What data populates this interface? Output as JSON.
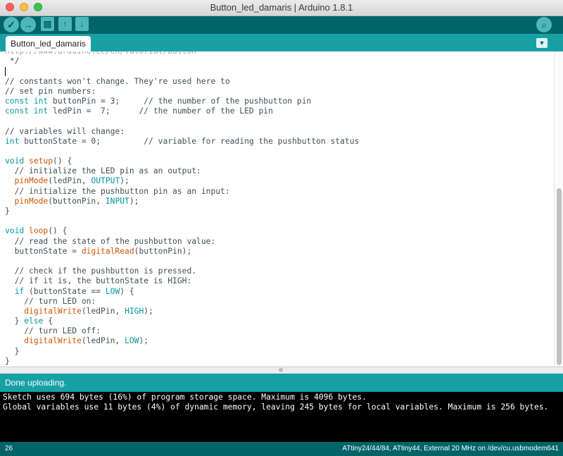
{
  "window": {
    "title": "Button_led_damaris | Arduino 1.8.1"
  },
  "toolbar": {
    "verify_icon": "✓",
    "upload_icon": "→",
    "new_icon": "▤",
    "open_icon": "↑",
    "save_icon": "↓",
    "serial_icon": "⌕"
  },
  "tabs": [
    {
      "label": "Button_led_damaris"
    }
  ],
  "tab_menu_icon": "▼",
  "editor": {
    "lines": [
      [
        {
          "t": "http://www.arduino.cc/en/Tutorial/Button",
          "c": "fade"
        }
      ],
      [
        {
          "t": " */",
          "c": "cmt"
        }
      ],
      [
        {
          "t": "",
          "c": "caret"
        }
      ],
      [
        {
          "t": "// constants won't change. They're used here to",
          "c": "cmt"
        }
      ],
      [
        {
          "t": "// set pin numbers:",
          "c": "cmt"
        }
      ],
      [
        {
          "t": "const",
          "c": "kw"
        },
        {
          "t": " "
        },
        {
          "t": "int",
          "c": "kw"
        },
        {
          "t": " buttonPin = 3;     "
        },
        {
          "t": "// the number of the pushbutton pin",
          "c": "cmt"
        }
      ],
      [
        {
          "t": "const",
          "c": "kw"
        },
        {
          "t": " "
        },
        {
          "t": "int",
          "c": "kw"
        },
        {
          "t": " ledPin =  7;      "
        },
        {
          "t": "// the number of the LED pin",
          "c": "cmt"
        }
      ],
      [
        {
          "t": ""
        }
      ],
      [
        {
          "t": "// variables will change:",
          "c": "cmt"
        }
      ],
      [
        {
          "t": "int",
          "c": "kw"
        },
        {
          "t": " buttonState = 0;         "
        },
        {
          "t": "// variable for reading the pushbutton status",
          "c": "cmt"
        }
      ],
      [
        {
          "t": ""
        }
      ],
      [
        {
          "t": "void",
          "c": "kw"
        },
        {
          "t": " "
        },
        {
          "t": "setup",
          "c": "fn"
        },
        {
          "t": "() {"
        }
      ],
      [
        {
          "t": "  // initialize the LED pin as an output:",
          "c": "cmt"
        }
      ],
      [
        {
          "t": "  "
        },
        {
          "t": "pinMode",
          "c": "fn"
        },
        {
          "t": "(ledPin, "
        },
        {
          "t": "OUTPUT",
          "c": "lit"
        },
        {
          "t": ");"
        }
      ],
      [
        {
          "t": "  // initialize the pushbutton pin as an input:",
          "c": "cmt"
        }
      ],
      [
        {
          "t": "  "
        },
        {
          "t": "pinMode",
          "c": "fn"
        },
        {
          "t": "(buttonPin, "
        },
        {
          "t": "INPUT",
          "c": "lit"
        },
        {
          "t": ");"
        }
      ],
      [
        {
          "t": "}"
        }
      ],
      [
        {
          "t": ""
        }
      ],
      [
        {
          "t": "void",
          "c": "kw"
        },
        {
          "t": " "
        },
        {
          "t": "loop",
          "c": "fn"
        },
        {
          "t": "() {"
        }
      ],
      [
        {
          "t": "  // read the state of the pushbutton value:",
          "c": "cmt"
        }
      ],
      [
        {
          "t": "  buttonState = "
        },
        {
          "t": "digitalRead",
          "c": "fn"
        },
        {
          "t": "(buttonPin);"
        }
      ],
      [
        {
          "t": ""
        }
      ],
      [
        {
          "t": "  // check if the pushbutton is pressed.",
          "c": "cmt"
        }
      ],
      [
        {
          "t": "  // if it is, the buttonState is HIGH:",
          "c": "cmt"
        }
      ],
      [
        {
          "t": "  "
        },
        {
          "t": "if",
          "c": "kw"
        },
        {
          "t": " (buttonState == "
        },
        {
          "t": "LOW",
          "c": "lit"
        },
        {
          "t": ") {"
        }
      ],
      [
        {
          "t": "    // turn LED on:",
          "c": "cmt"
        }
      ],
      [
        {
          "t": "    "
        },
        {
          "t": "digitalWrite",
          "c": "fn"
        },
        {
          "t": "(ledPin, "
        },
        {
          "t": "HIGH",
          "c": "lit"
        },
        {
          "t": ");"
        }
      ],
      [
        {
          "t": "  } "
        },
        {
          "t": "else",
          "c": "kw"
        },
        {
          "t": " {"
        }
      ],
      [
        {
          "t": "    // turn LED off:",
          "c": "cmt"
        }
      ],
      [
        {
          "t": "    "
        },
        {
          "t": "digitalWrite",
          "c": "fn"
        },
        {
          "t": "(ledPin, "
        },
        {
          "t": "LOW",
          "c": "lit"
        },
        {
          "t": ");"
        }
      ],
      [
        {
          "t": "  }"
        }
      ],
      [
        {
          "t": "}"
        }
      ]
    ]
  },
  "status": {
    "message": "Done uploading."
  },
  "console": {
    "lines": [
      "Sketch uses 694 bytes (16%) of program storage space. Maximum is 4096 bytes.",
      "Global variables use 11 bytes (4%) of dynamic memory, leaving 245 bytes for local variables. Maximum is 256 bytes."
    ]
  },
  "footer": {
    "line_number": "26",
    "board_info": "ATtiny24/44/84, ATtiny44, External 20 MHz on /dev/cu.usbmodem641"
  },
  "colors": {
    "toolbar": "#006468",
    "accent": "#17a1a5",
    "button": "#4db7bb",
    "keyword": "#00979c",
    "function": "#d35400"
  }
}
